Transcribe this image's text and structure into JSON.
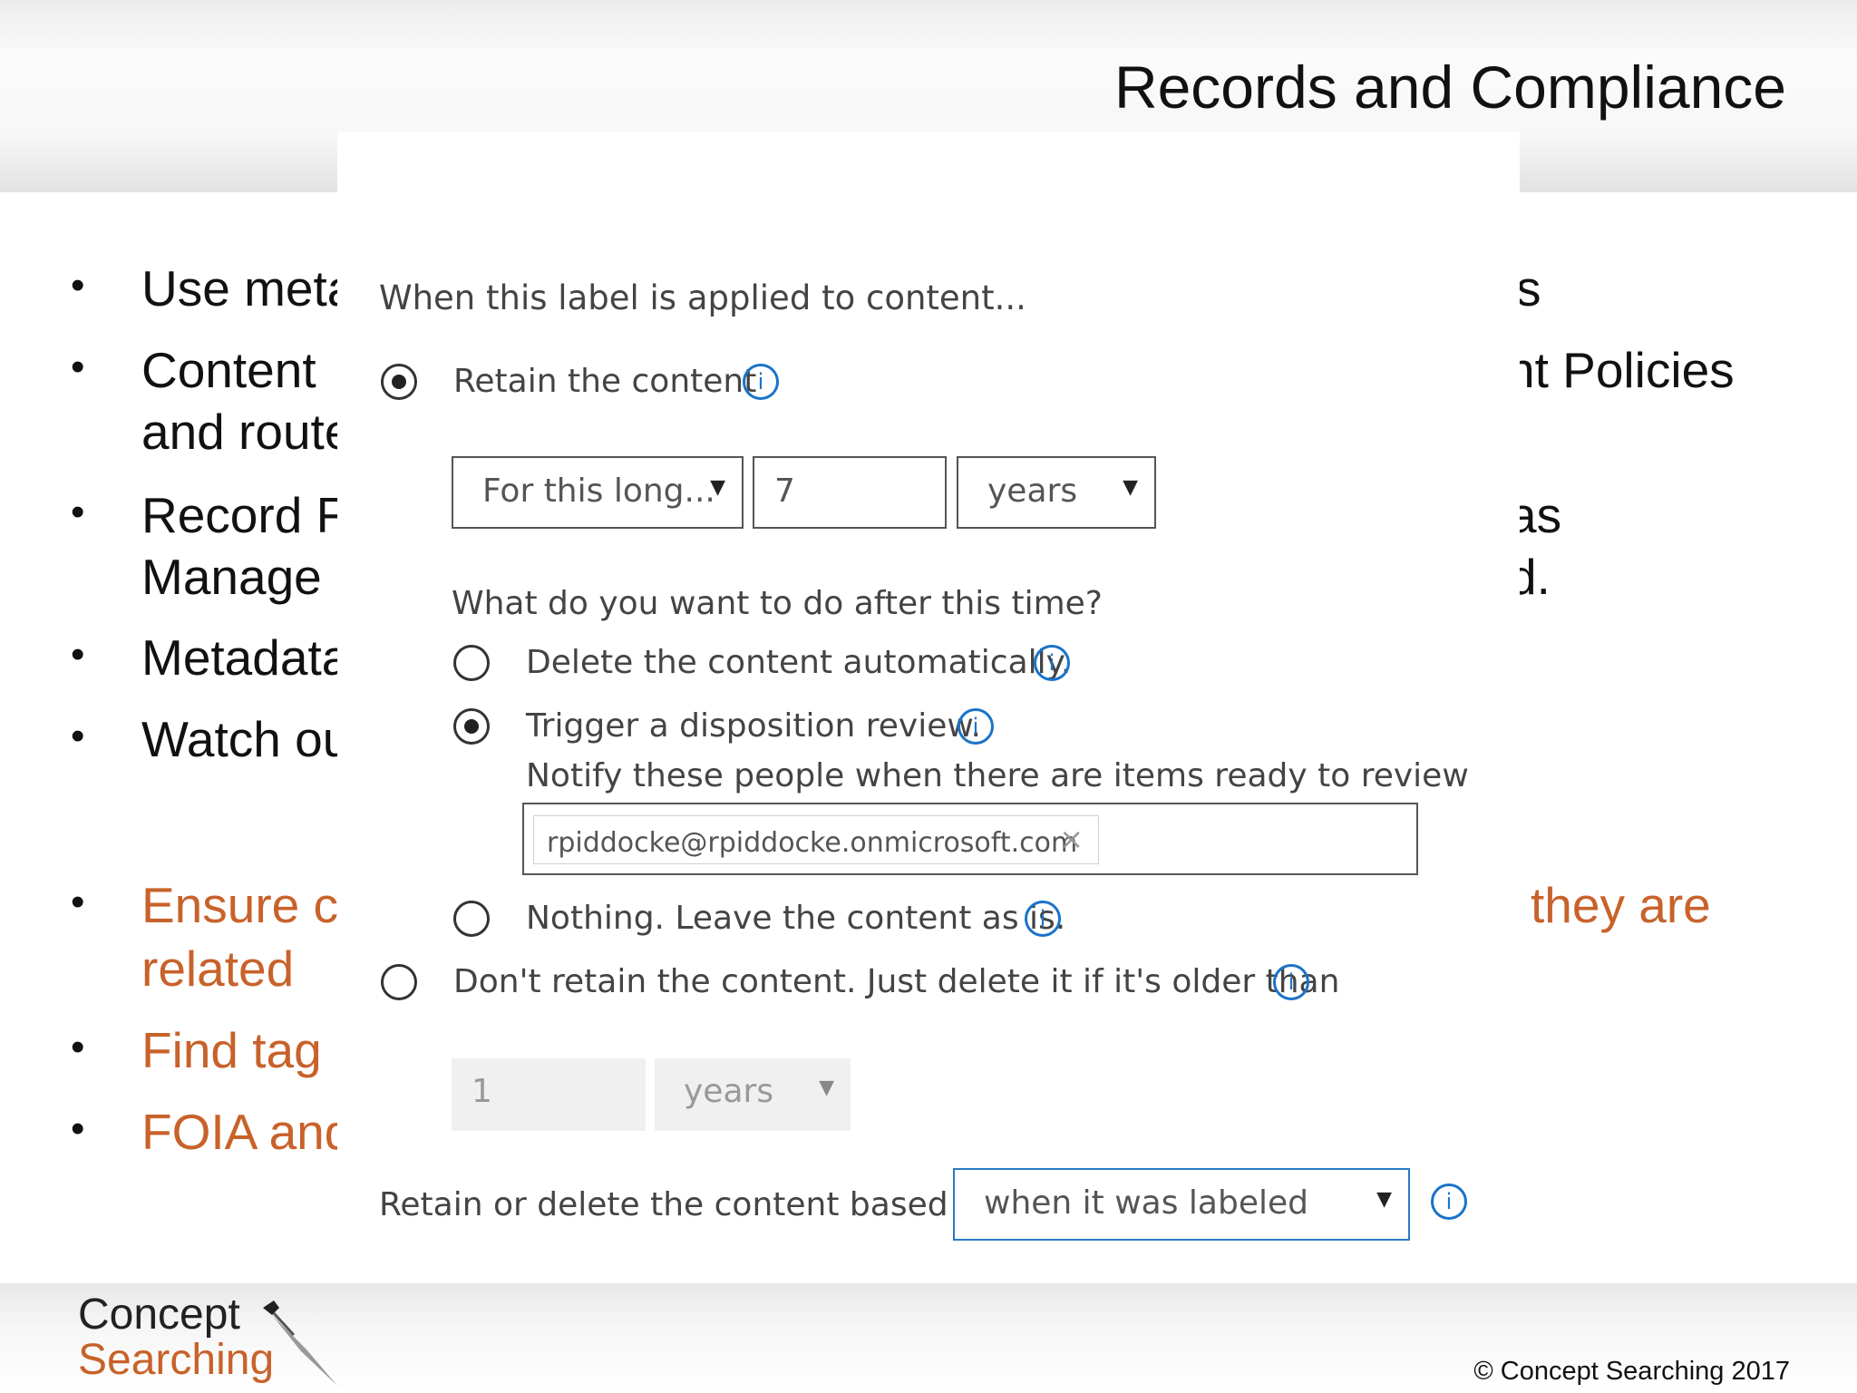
{
  "slide": {
    "title": "Records and Compliance",
    "copyright": "© Concept Searching 2017",
    "logo": {
      "line1": "Concept",
      "line2": "Searching"
    },
    "bullet_glyph": "•",
    "bullets_left": [
      "Use meta",
      "Content",
      "and route",
      "Record F",
      "Manage",
      "Metadata",
      "Watch ou",
      "Ensure c",
      "related",
      "Find tag",
      "FOIA and"
    ],
    "bullets_right": [
      "s",
      "nt Policies",
      "as",
      "d.",
      "they are"
    ]
  },
  "dialog": {
    "heading": "When this label is applied to content...",
    "retain_label": "Retain the content",
    "duration_select": "For this long...",
    "duration_value": "7",
    "unit_select": "years",
    "after_question": "What do you want to do after this time?",
    "delete_auto_label": "Delete the content automatically.",
    "trigger_review_label": "Trigger a disposition review.",
    "notify_label": "Notify these people when there are items ready to review",
    "notify_person": "rpiddocke@rpiddocke.onmicrosoft.com",
    "remove_glyph": "×",
    "nothing_label": "Nothing. Leave the content as is.",
    "dont_retain_label": "Don't retain the content. Just delete it if it's older than",
    "older_value": "1",
    "older_unit": "years",
    "based_on_label": "Retain or delete the content based on",
    "based_on_select": "when it was labeled",
    "info_glyph": "i",
    "caret_glyph": "▼"
  }
}
